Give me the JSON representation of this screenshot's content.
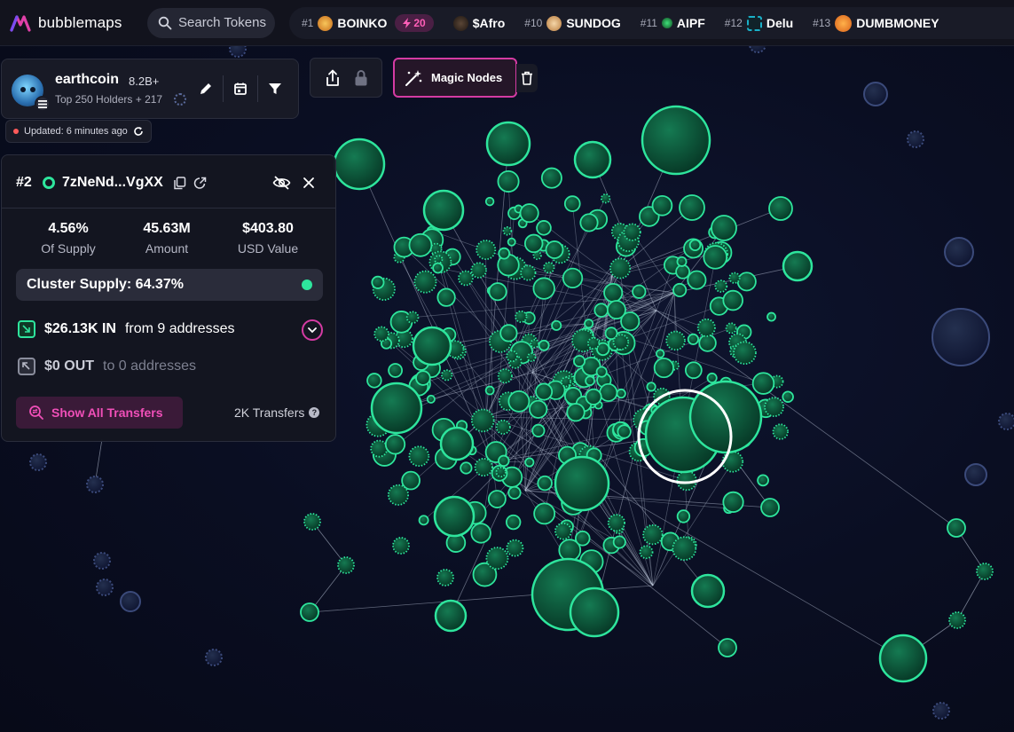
{
  "brand": {
    "name": "bubblemaps"
  },
  "search": {
    "placeholder": "Search Tokens"
  },
  "trending": [
    {
      "rank": "#1",
      "name": "BOINKO",
      "icon": "boinko-token-icon",
      "color": "#e2a020",
      "boost": "20"
    },
    {
      "rank": "",
      "name": "$Afro",
      "icon": "afro-token-icon",
      "color": "#3a2a20",
      "boost": ""
    },
    {
      "rank": "#10",
      "name": "SUNDOG",
      "icon": "sundog-token-icon",
      "color": "#e8b070",
      "boost": ""
    },
    {
      "rank": "#11",
      "name": "AIPF",
      "icon": "aipf-token-icon",
      "color": "#2bbf55",
      "boost": ""
    },
    {
      "rank": "#12",
      "name": "Delu",
      "icon": "delu-token-icon",
      "color": "#1ab0c8",
      "boost": ""
    },
    {
      "rank": "#13",
      "name": "DUMBMONEY",
      "icon": "dumbmoney-token-icon",
      "color": "#f08a24",
      "boost": ""
    }
  ],
  "token": {
    "name": "earthcoin",
    "supply": "8.2B+",
    "subtitle": "Top 250 Holders + 217",
    "updated": "Updated: 6 minutes ago"
  },
  "toolbar": {
    "magic_nodes": "Magic Nodes"
  },
  "wallet": {
    "rank": "#2",
    "address": "7zNeNd...VgXX",
    "stats": [
      {
        "value": "4.56%",
        "label": "Of Supply"
      },
      {
        "value": "45.63M",
        "label": "Amount"
      },
      {
        "value": "$403.80",
        "label": "USD Value"
      }
    ],
    "cluster_supply": "Cluster Supply: 64.37%",
    "in_amount": "$26.13K IN",
    "in_from": "from 9 addresses",
    "out_amount": "$0 OUT",
    "out_to": "to 0 addresses",
    "show_all": "Show All Transfers",
    "transfers": "2K Transfers"
  },
  "colors": {
    "accent": "#d43ba3",
    "node_green": "#2ee59d",
    "node_fill": "#0b4a33",
    "isolated_node": "#2c3658"
  }
}
